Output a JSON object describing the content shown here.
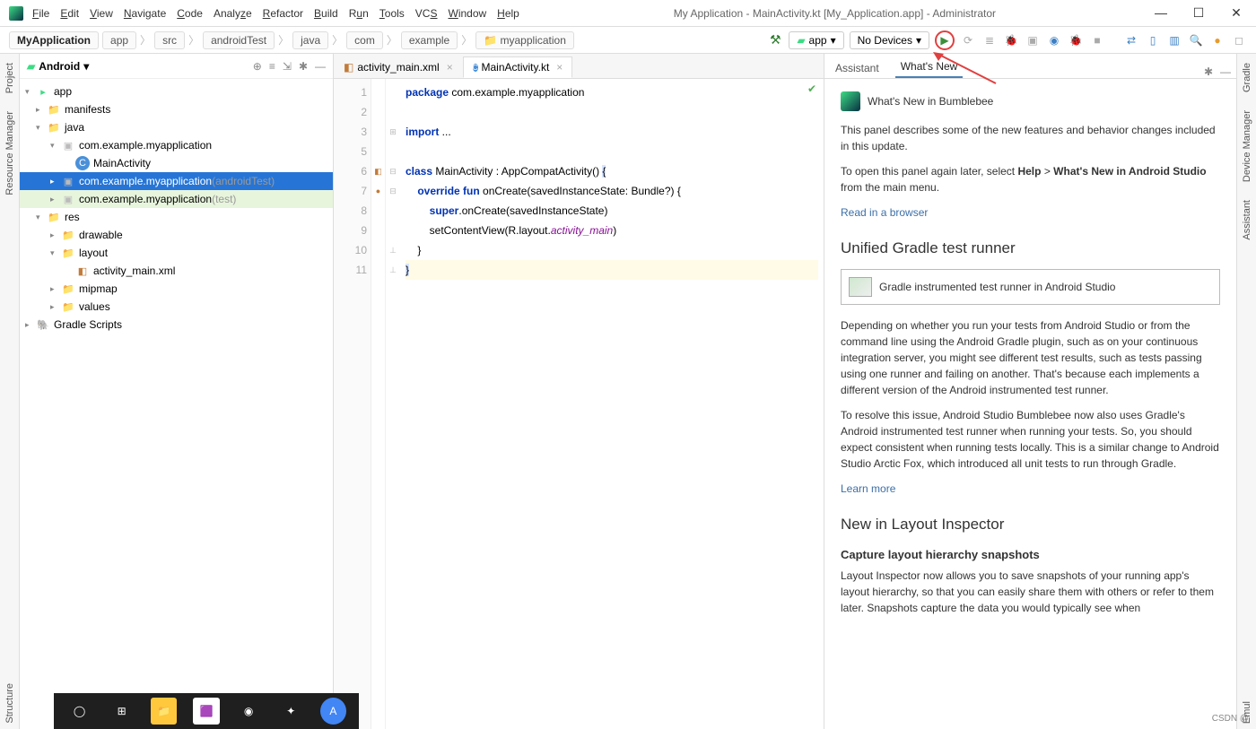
{
  "window": {
    "title": "My Application - MainActivity.kt [My_Application.app] - Administrator"
  },
  "menu": [
    "File",
    "Edit",
    "View",
    "Navigate",
    "Code",
    "Analyze",
    "Refactor",
    "Build",
    "Run",
    "Tools",
    "VCS",
    "Window",
    "Help"
  ],
  "breadcrumb": [
    "MyApplication",
    "app",
    "src",
    "androidTest",
    "java",
    "com",
    "example",
    "myapplication"
  ],
  "run": {
    "config": "app",
    "device": "No Devices"
  },
  "project": {
    "mode": "Android",
    "tree": [
      {
        "d": 0,
        "arr": "down",
        "icon": "app",
        "label": "app"
      },
      {
        "d": 1,
        "arr": "right",
        "icon": "folder",
        "label": "manifests"
      },
      {
        "d": 1,
        "arr": "down",
        "icon": "bluef",
        "label": "java"
      },
      {
        "d": 2,
        "arr": "down",
        "icon": "pkg",
        "label": "com.example.myapplication"
      },
      {
        "d": 3,
        "arr": "",
        "icon": "kt",
        "label": "MainActivity"
      },
      {
        "d": 2,
        "arr": "right",
        "icon": "pkg",
        "label": "com.example.myapplication",
        "suffix": "(androidTest)",
        "sel": true
      },
      {
        "d": 2,
        "arr": "right",
        "icon": "pkg",
        "label": "com.example.myapplication",
        "suffix": "(test)",
        "hl": true
      },
      {
        "d": 1,
        "arr": "down",
        "icon": "bluef",
        "label": "res"
      },
      {
        "d": 2,
        "arr": "right",
        "icon": "folder",
        "label": "drawable"
      },
      {
        "d": 2,
        "arr": "down",
        "icon": "folder",
        "label": "layout"
      },
      {
        "d": 3,
        "arr": "",
        "icon": "xml",
        "label": "activity_main.xml"
      },
      {
        "d": 2,
        "arr": "right",
        "icon": "folder",
        "label": "mipmap"
      },
      {
        "d": 2,
        "arr": "right",
        "icon": "folder",
        "label": "values"
      },
      {
        "d": 0,
        "arr": "right",
        "icon": "gradle",
        "label": "Gradle Scripts"
      }
    ]
  },
  "editor": {
    "tabs": [
      {
        "icon": "xml",
        "label": "activity_main.xml",
        "active": false
      },
      {
        "icon": "kt",
        "label": "MainActivity.kt",
        "active": true
      }
    ],
    "lines": [
      1,
      2,
      3,
      5,
      6,
      7,
      8,
      9,
      10,
      11
    ],
    "code": {
      "l1a": "package",
      "l1b": " com.example.myapplication",
      "l3a": "import",
      "l3b": " ...",
      "l6a": "class",
      "l6b": " MainActivity : AppCompatActivity() ",
      "l6c": "{",
      "l7a": "    override fun",
      "l7b": " onCreate(savedInstanceState: Bundle?) {",
      "l8a": "        super",
      "l8b": ".onCreate(savedInstanceState)",
      "l9a": "        setContentView(R.layout.",
      "l9b": "activity_main",
      "l9c": ")",
      "l10": "    }",
      "l11": "}"
    }
  },
  "whatsNew": {
    "tabs": [
      "Assistant",
      "What's New"
    ],
    "heading": "What's New in Bumblebee",
    "intro": "This panel describes some of the new features and behavior changes included in this update.",
    "openAgain_a": "To open this panel again later, select ",
    "openAgain_b": "Help",
    "openAgain_c": " > ",
    "openAgain_d": "What's New in Android Studio",
    "openAgain_e": " from the main menu.",
    "readLink": "Read in a browser",
    "h2a": "Unified Gradle test runner",
    "boxText": "Gradle instrumented test runner in Android Studio",
    "p1": "Depending on whether you run your tests from Android Studio or from the command line using the Android Gradle plugin, such as on your continuous integration server, you might see different test results, such as tests passing using one runner and failing on another. That's because each implements a different version of the Android instrumented test runner.",
    "p2": "To resolve this issue, Android Studio Bumblebee now also uses Gradle's Android instrumented test runner when running your tests. So, you should expect consistent when running tests locally. This is a similar change to Android Studio Arctic Fox, which introduced all unit tests to run through Gradle.",
    "learnMore": "Learn more",
    "h2b": "New in Layout Inspector",
    "h3": "Capture layout hierarchy snapshots",
    "p3": "Layout Inspector now allows you to save snapshots of your running app's layout hierarchy, so that you can easily share them with others or refer to them later. Snapshots capture the data you would typically see when"
  },
  "rails": {
    "left": [
      "Project",
      "Resource Manager"
    ],
    "right": [
      "Gradle",
      "Device Manager",
      "Assistant",
      "Emul"
    ]
  },
  "leftRail": {
    "structure": "Structure"
  },
  "corner": "CSDN @"
}
